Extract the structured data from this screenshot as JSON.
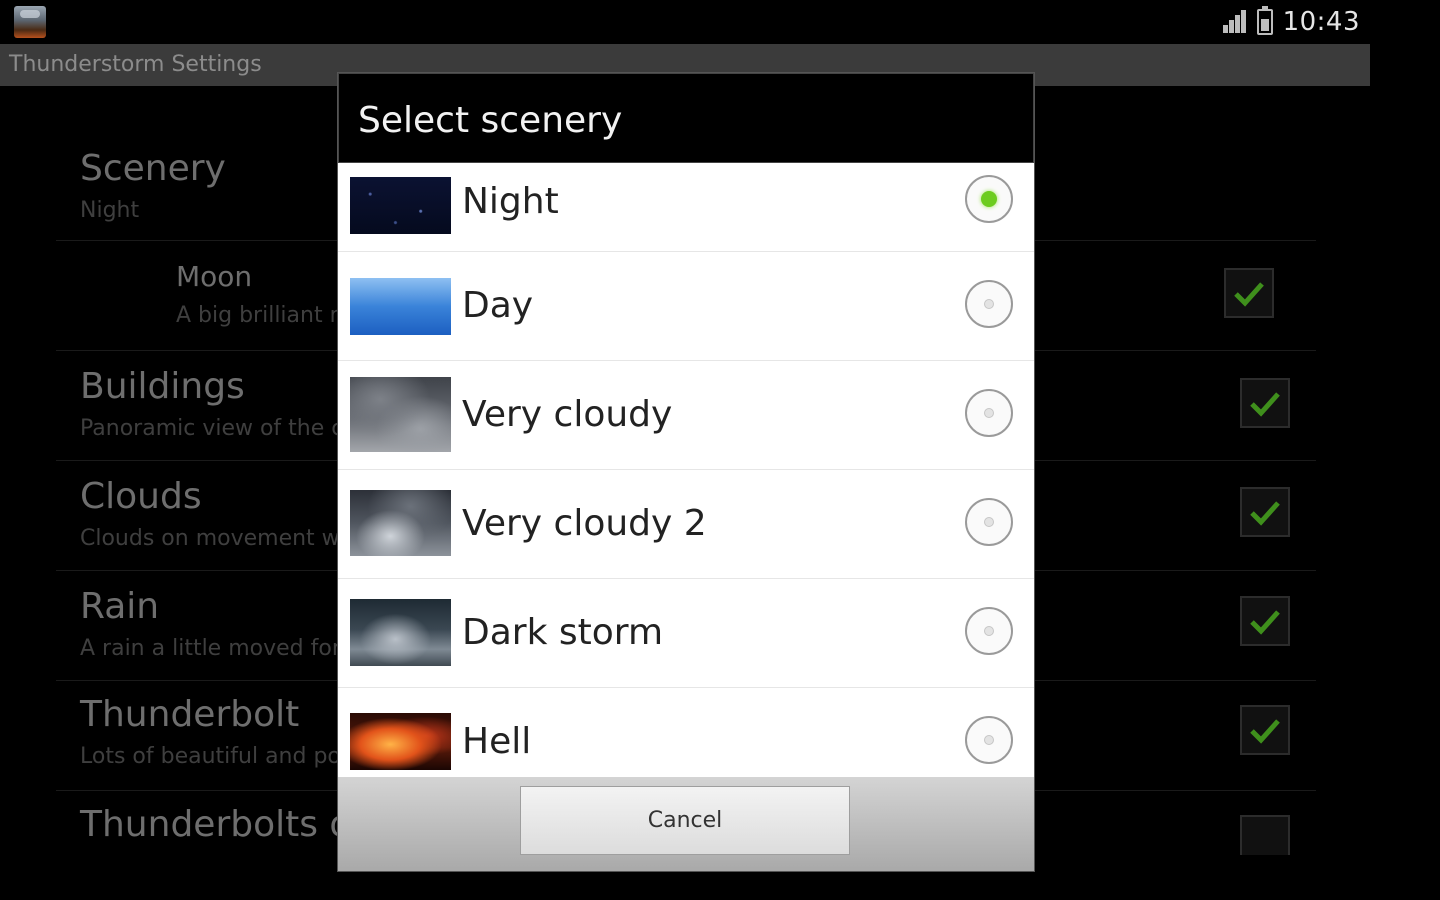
{
  "status_bar": {
    "time": "10:43",
    "icons": [
      "app-icon",
      "signal-icon",
      "battery-icon"
    ]
  },
  "app": {
    "title": "Thunderstorm Settings"
  },
  "preferences": [
    {
      "title": "Scenery",
      "summary": "Night",
      "checkbox": null
    },
    {
      "title": "Moon",
      "summary": "A big brilliant m",
      "checkbox": true
    },
    {
      "title": "Buildings",
      "summary": "Panoramic view of the c",
      "checkbox": true
    },
    {
      "title": "Clouds",
      "summary": "Clouds on movement wi",
      "checkbox": true
    },
    {
      "title": "Rain",
      "summary": "A rain a little moved for t",
      "checkbox": true
    },
    {
      "title": "Thunderbolt",
      "summary": "Lots of beautiful and po",
      "checkbox": true
    },
    {
      "title": "Thunderbolts o",
      "summary": "",
      "checkbox": false
    }
  ],
  "dialog": {
    "title": "Select scenery",
    "options": [
      {
        "label": "Night",
        "selected": true,
        "thumb": "night"
      },
      {
        "label": "Day",
        "selected": false,
        "thumb": "day"
      },
      {
        "label": "Very cloudy",
        "selected": false,
        "thumb": "very-cloudy"
      },
      {
        "label": "Very cloudy 2",
        "selected": false,
        "thumb": "very-cloudy-2"
      },
      {
        "label": "Dark storm",
        "selected": false,
        "thumb": "dark-storm"
      },
      {
        "label": "Hell",
        "selected": false,
        "thumb": "hell"
      }
    ],
    "cancel_label": "Cancel"
  },
  "colors": {
    "radio_selected": "#6dcc1f",
    "check_mark": "#3f8f1c",
    "title_bar": "#3b3b3b"
  }
}
